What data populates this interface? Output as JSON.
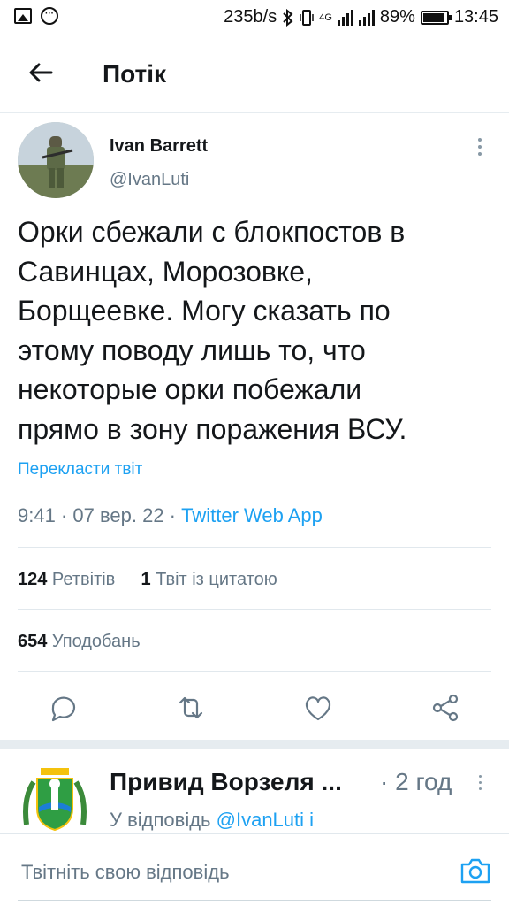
{
  "status_bar": {
    "speed": "235b/s",
    "network": "4G",
    "battery": "89%",
    "time": "13:45",
    "icons": [
      "image-icon",
      "chat-dots-icon",
      "bluetooth-icon",
      "vibrate-icon",
      "signal-icon",
      "battery-icon"
    ]
  },
  "header": {
    "title": "Потік",
    "back_icon": "arrow-left-icon"
  },
  "tweet": {
    "name": "Ivan Barrett",
    "handle": "@IvanLuti",
    "text": "Орки сбежали с блокпостов в\nСавинцах, Морозовке,\nБорщеевке. Могу сказать по\nэтому поводу лишь то, что\nнекоторые орки побежали\nпрямо в зону поражения ВСУ.",
    "translate": "Перекласти твіт",
    "time": "9:41 · 07 вер. 22 · ",
    "app": "Twitter Web App",
    "retweets_count": "124",
    "retweets_label": " Ретвітів",
    "quotes_count": "1",
    "quotes_label": " Твіт із цитатою",
    "likes_count": "654",
    "likes_label": " Уподобань"
  },
  "reply": {
    "name": "Привид Ворзеля ...",
    "time": "· 2 год",
    "reply_prefix": "У відповідь ",
    "reply_link": "@IvanLuti і"
  },
  "composer": {
    "placeholder": "Твітніть свою відповідь"
  },
  "colors": {
    "accent": "#1da1f2",
    "muted": "#657786",
    "text": "#14171a",
    "divider": "#e1e8ed"
  }
}
